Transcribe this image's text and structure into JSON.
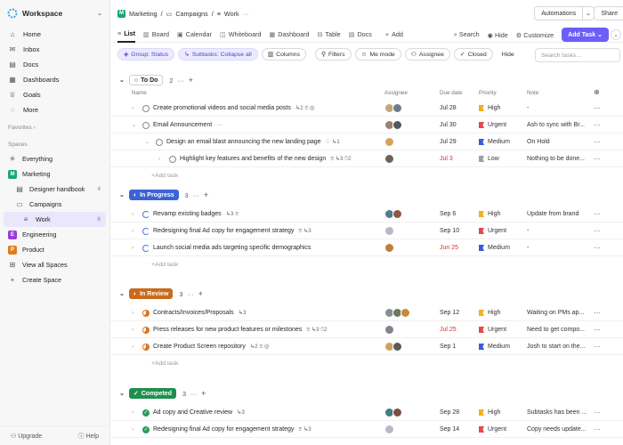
{
  "sidebar": {
    "workspace": "Workspace",
    "nav": [
      {
        "label": "Home",
        "icon": "home-icon"
      },
      {
        "label": "Inbox",
        "icon": "inbox-icon"
      },
      {
        "label": "Docs",
        "icon": "doc-icon"
      },
      {
        "label": "Dashboards",
        "icon": "dashboard-icon"
      },
      {
        "label": "Goals",
        "icon": "trophy-icon"
      },
      {
        "label": "More",
        "icon": "more-icon"
      }
    ],
    "favorites": "Favorites",
    "spaces_label": "Spaces",
    "spaces": [
      {
        "label": "Everything",
        "icon": "sparkle-icon"
      },
      {
        "label": "Marketing",
        "letter": "M",
        "color": "#1aa67a"
      },
      {
        "label": "Designer handbook",
        "count": "4",
        "icon": "doc-icon"
      },
      {
        "label": "Campaigns",
        "icon": "folder-icon"
      },
      {
        "label": "Work",
        "count": "6",
        "icon": "list-icon"
      },
      {
        "label": "Engineering",
        "letter": "E",
        "color": "#9b3bd6"
      },
      {
        "label": "Product",
        "letter": "P",
        "color": "#e07b1d"
      },
      {
        "label": "View all Spaces",
        "icon": "grid-icon"
      },
      {
        "label": "Create Space",
        "icon": "plus-icon"
      }
    ],
    "upgrade": "Upgrade",
    "help": "Help"
  },
  "breadcrumb": {
    "space": "Marketing",
    "folder": "Campaigns",
    "list": "Work",
    "more": "···"
  },
  "top_actions": {
    "automations": "Automations",
    "share": "Share"
  },
  "views": [
    {
      "label": "List",
      "icon": "list-icon"
    },
    {
      "label": "Board",
      "icon": "board-icon"
    },
    {
      "label": "Calendar",
      "icon": "calendar-icon"
    },
    {
      "label": "Whiteboard",
      "icon": "whiteboard-icon"
    },
    {
      "label": "Dashboard",
      "icon": "dashboard-icon"
    },
    {
      "label": "Table",
      "icon": "table-icon"
    },
    {
      "label": "Docs",
      "icon": "doc-icon"
    },
    {
      "label": "Add",
      "icon": "plus-icon"
    }
  ],
  "view_tools": {
    "search": "Search",
    "hide": "Hide",
    "customize": "Customize",
    "add_task": "Add Task"
  },
  "filters": {
    "group": "Group: Status",
    "subtasks": "Subtasks: Collapse all",
    "columns": "Columns",
    "filters": "Filters",
    "me": "Me mode",
    "assignee": "Assignee",
    "closed": "Closed",
    "hide": "Hide",
    "search_placeholder": "Search tasks..."
  },
  "columns": {
    "name": "Name",
    "assignee": "Assignee",
    "due": "Due date",
    "priority": "Priority",
    "note": "Note"
  },
  "add_task_label": "Add task",
  "colors": {
    "high": "#f2b21b",
    "urgent": "#e5484d",
    "medium": "#3b5bdb",
    "low": "#9aa0a6",
    "in_progress": "#3b63d6",
    "in_review": "#c96a1c",
    "completed": "#1f8f4e",
    "accent": "#6d5ef7"
  },
  "groups": [
    {
      "label": "To Do",
      "count": "2",
      "style": "todo",
      "status": "todo",
      "tasks": [
        {
          "name": "Create promotional videos and social media posts",
          "meta": "↳2 ≡ ◎",
          "indent": 0,
          "caret": "›",
          "due": "Jul 28",
          "red": false,
          "prio": "High",
          "note": "-",
          "av": [
            "#c7a37c",
            "#6b7c8f"
          ]
        },
        {
          "name": "Email Announcement",
          "meta": "···",
          "indent": 0,
          "caret": "⌄",
          "due": "Jul 30",
          "red": false,
          "prio": "Urgent",
          "note": "Ash to sync with Br...",
          "av": [
            "#9a8070",
            "#4e5a66"
          ]
        },
        {
          "name": "Design an email blast announcing the new landing page",
          "meta": "♢ ↳1",
          "indent": 1,
          "caret": "⌄",
          "due": "Jul 29",
          "red": false,
          "prio": "Medium",
          "note": "On Hold",
          "av": [
            "#d9a25a"
          ]
        },
        {
          "name": "Highlight key features and benefits of the new design",
          "meta": "≡ ↳3 ⍥2",
          "indent": 2,
          "caret": "›",
          "due": "Jul 3",
          "red": true,
          "prio": "Low",
          "note": "Nothing to be done...",
          "av": [
            "#6e6358"
          ]
        }
      ]
    },
    {
      "label": "In Progress",
      "count": "3",
      "style": "in_progress",
      "status": "ip",
      "tasks": [
        {
          "name": "Revamp existing badges",
          "meta": "↳3 ≡",
          "indent": 0,
          "caret": "›",
          "due": "Sep 6",
          "red": false,
          "prio": "High",
          "note": "Update from brand",
          "av": [
            "#4d7e8f",
            "#8a5a44"
          ]
        },
        {
          "name": "Redesigning final Ad copy for engagement strategy",
          "meta": "≡ ↳3",
          "indent": 0,
          "caret": "›",
          "due": "Sep 10",
          "red": false,
          "prio": "Urgent",
          "note": "-",
          "av": [
            "#b8b8c8"
          ]
        },
        {
          "name": "Launch social media ads targeting specific demographics",
          "meta": "",
          "indent": 0,
          "caret": "›",
          "due": "Jun 25",
          "red": true,
          "prio": "Medium",
          "note": "-",
          "av": [
            "#c27c3a"
          ]
        }
      ]
    },
    {
      "label": "In Review",
      "count": "3",
      "style": "in_review",
      "status": "rev",
      "tasks": [
        {
          "name": "Contracts/Invoices/Proposals",
          "meta": "↳3",
          "indent": 0,
          "caret": "›",
          "due": "Sep 12",
          "red": false,
          "prio": "High",
          "note": "Waiting on PMs ap...",
          "av": [
            "#8a8f96",
            "#6b7a5e",
            "#c68a3c"
          ]
        },
        {
          "name": "Press releases for new product features or milestones",
          "meta": "≡ ↳3 ⍥2",
          "indent": 0,
          "caret": "›",
          "due": "Jul 25",
          "red": true,
          "prio": "Urgent",
          "note": "Need to get compo...",
          "av": [
            "#7e858c"
          ]
        },
        {
          "name": "Create Product Screen repository",
          "meta": "↳2 ≡ ◎",
          "indent": 0,
          "caret": "›",
          "due": "Sep 1",
          "red": false,
          "prio": "Medium",
          "note": "Josh to start on the...",
          "av": [
            "#d0a060",
            "#5a5a5a"
          ]
        }
      ]
    },
    {
      "label": "Competed",
      "count": "3",
      "style": "completed",
      "status": "done",
      "tasks": [
        {
          "name": "Ad copy and Creative review",
          "meta": "↳3",
          "indent": 0,
          "caret": "›",
          "due": "Sep 28",
          "red": false,
          "prio": "High",
          "note": "Subtasks has been ...",
          "av": [
            "#3f7f80",
            "#7a5040"
          ]
        },
        {
          "name": "Redesigning final Ad copy for engagement strategy",
          "meta": "≡ ↳3",
          "indent": 0,
          "caret": "›",
          "due": "Sep 14",
          "red": false,
          "prio": "Urgent",
          "note": "Copy needs update...",
          "av": [
            "#b8b8c8"
          ]
        }
      ]
    }
  ]
}
